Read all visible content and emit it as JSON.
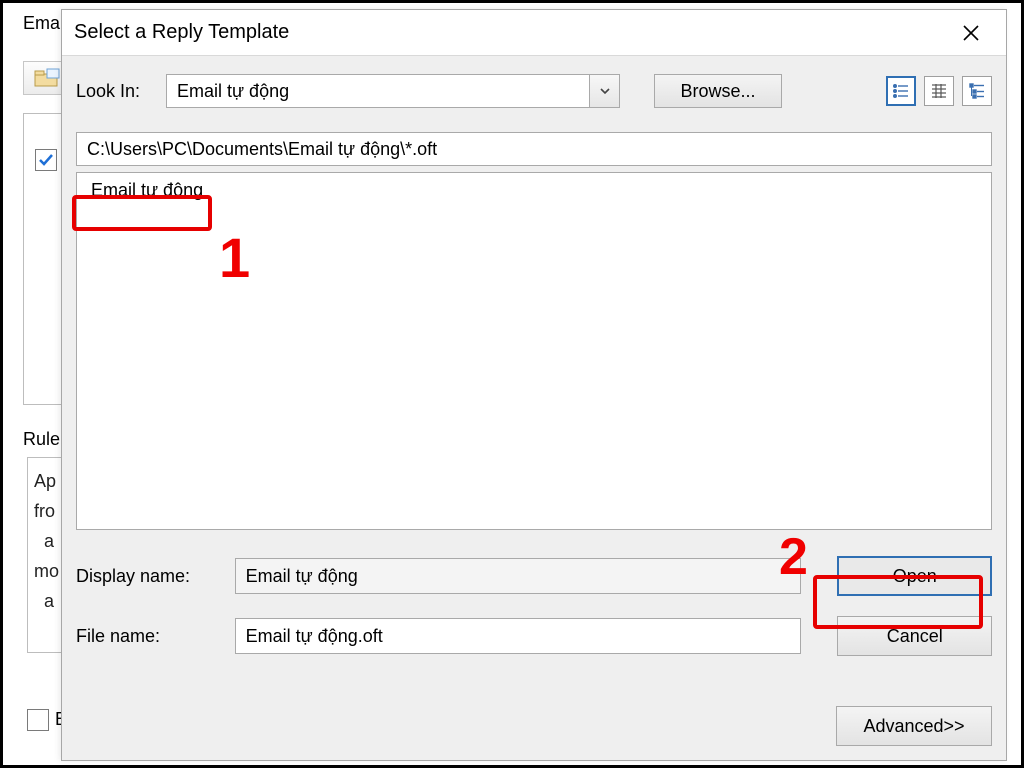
{
  "background": {
    "top_label_fragment": "Emai",
    "rule_label_fragment": "Rule",
    "rule_text_fragment": "Ap\nfro\n  a\nmo\n  a",
    "checkbox2_label_fragment": "E"
  },
  "dialog": {
    "title": "Select a Reply Template",
    "look_in_label": "Look In:",
    "look_in_value": "Email tự động",
    "browse_label": "Browse...",
    "path": "C:\\Users\\PC\\Documents\\Email tự động\\*.oft",
    "file_item": "Email tự động",
    "display_name_label": "Display name:",
    "display_name_value": "Email tự động",
    "file_name_label": "File name:",
    "file_name_value": "Email tự động.oft",
    "open_label": "Open",
    "cancel_label": "Cancel",
    "advanced_label": "Advanced>>"
  },
  "annotations": {
    "callout_1": "1",
    "callout_2": "2"
  }
}
